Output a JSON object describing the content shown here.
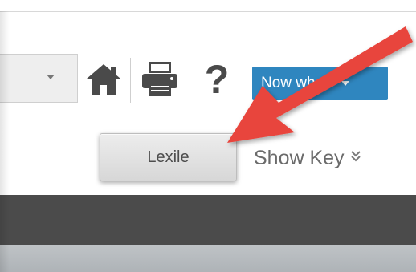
{
  "toolbar": {
    "dropdown_icon": "chevron-down-icon",
    "home_icon": "home-icon",
    "print_icon": "printer-icon",
    "help_label": "?",
    "now_what_label": "Now what?",
    "now_what_color": "#2f86bf"
  },
  "key_row": {
    "lexile_label": "Lexile",
    "show_key_label": "Show Key",
    "show_key_chevron": "»"
  },
  "annotation": {
    "arrow_color": "#e8453c",
    "arrow_icon": "callout-arrow"
  },
  "bars": {
    "dark_color": "#4b4b4b",
    "light_color": "#b7bbbe"
  }
}
